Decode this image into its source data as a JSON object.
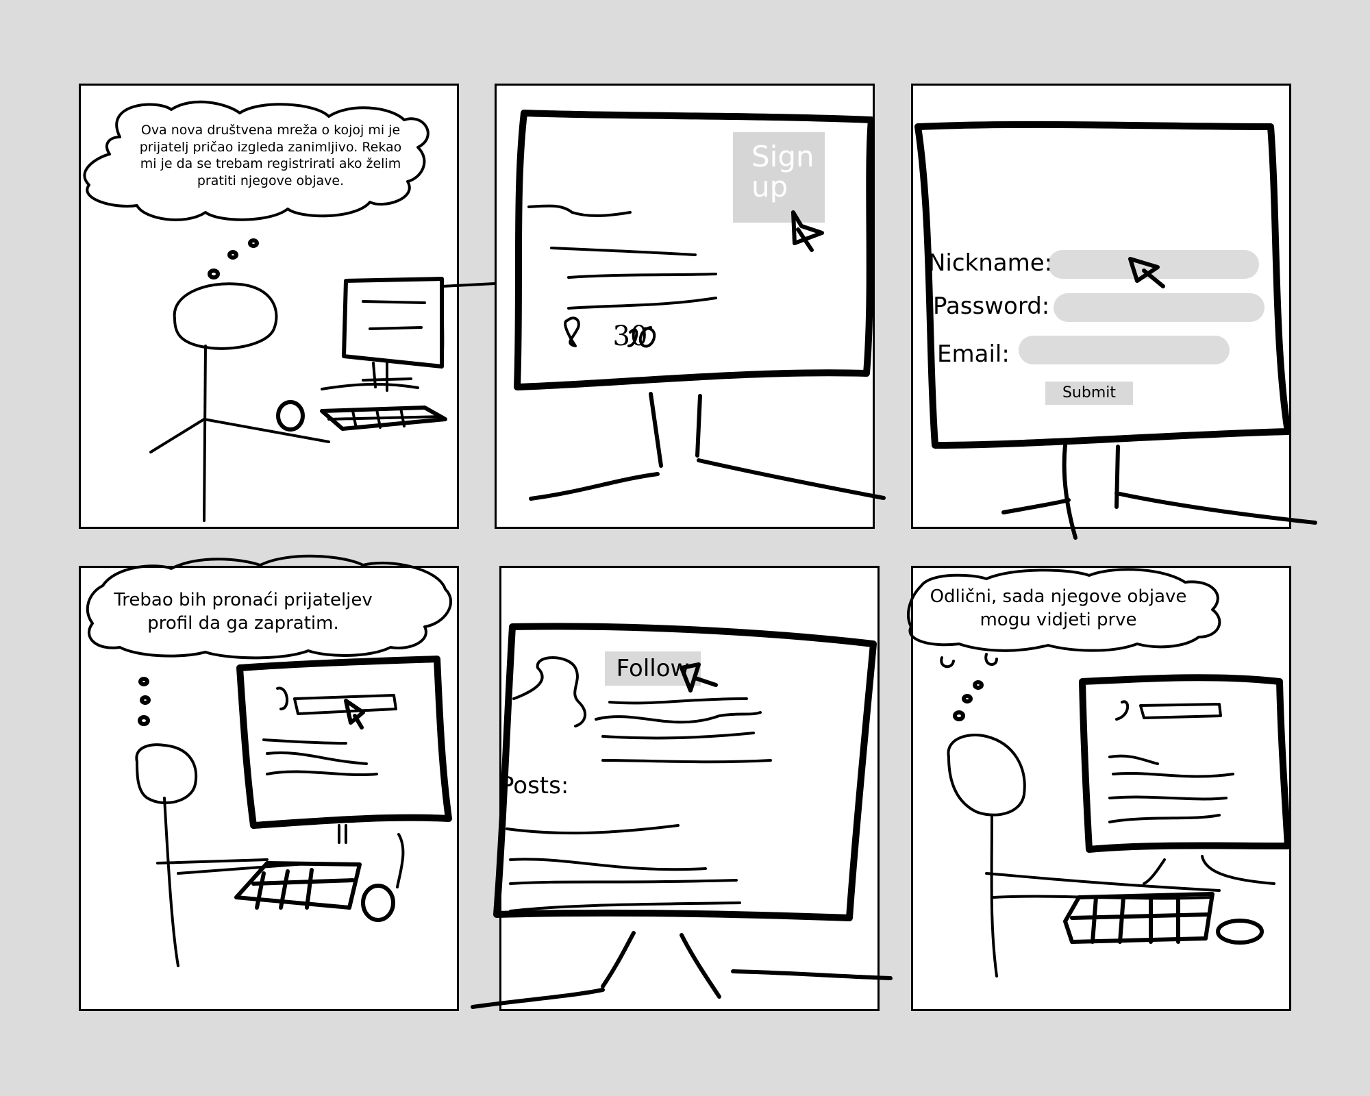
{
  "panels": {
    "p1": {
      "thought": "Ova nova društvena mreža o kojoj mi je prijatelj pričao izgleda zanimljivo. Rekao mi je da se trebam registrirati ako želim pratiti njegove objave."
    },
    "p2": {
      "signup_label": "Sign up",
      "likes_count": "30"
    },
    "p3": {
      "nickname_label": "Nickname:",
      "password_label": "Password:",
      "email_label": "Email:",
      "submit_label": "Submit"
    },
    "p4": {
      "thought": "Trebao bih pronaći prijateljev profil da ga zapratim."
    },
    "p5": {
      "follow_label": "Follow",
      "posts_label": "Posts:"
    },
    "p6": {
      "thought": "Odlični, sada njegove objave mogu vidjeti prve"
    }
  },
  "colors": {
    "background": "#dcdcdc",
    "panel": "#ffffff",
    "ink": "#000000",
    "button_gray": "#d9d9d9"
  },
  "icons": [
    "cursor-arrow-icon",
    "heart-icon"
  ]
}
